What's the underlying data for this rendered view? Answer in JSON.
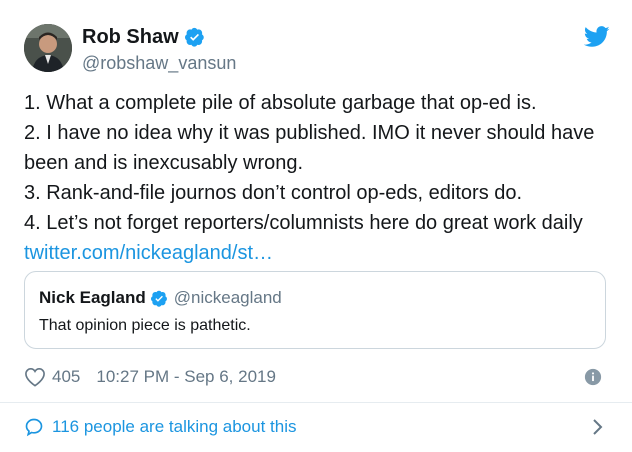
{
  "colors": {
    "link": "#1b95e0",
    "verified": "#1da1f2",
    "secondary_text": "#657786",
    "primary_text": "#14171a",
    "border": "#ccd6dd"
  },
  "tweet": {
    "author": {
      "name": "Rob Shaw",
      "handle": "@robshaw_vansun",
      "verified": true,
      "avatar_icon": "avatar-photo"
    },
    "brand_icon": "twitter-bird-icon",
    "lines": [
      "1. What a complete pile of absolute garbage that op-ed is.",
      "2. I have no idea why it was published. IMO it never should have",
      "been and is inexcusably wrong.",
      "3. Rank-and-file journos don’t control op-eds, editors do.",
      "4. Let’s not forget reporters/columnists here do great work daily"
    ],
    "link_text": "twitter.com/nickeagland/st…",
    "quoted": {
      "name": "Nick Eagland",
      "handle": "@nickeagland",
      "verified": true,
      "text": "That opinion piece is pathetic."
    },
    "likes": "405",
    "timestamp": "10:27 PM - Sep 6, 2019",
    "footer_text": "116 people are talking about this"
  }
}
